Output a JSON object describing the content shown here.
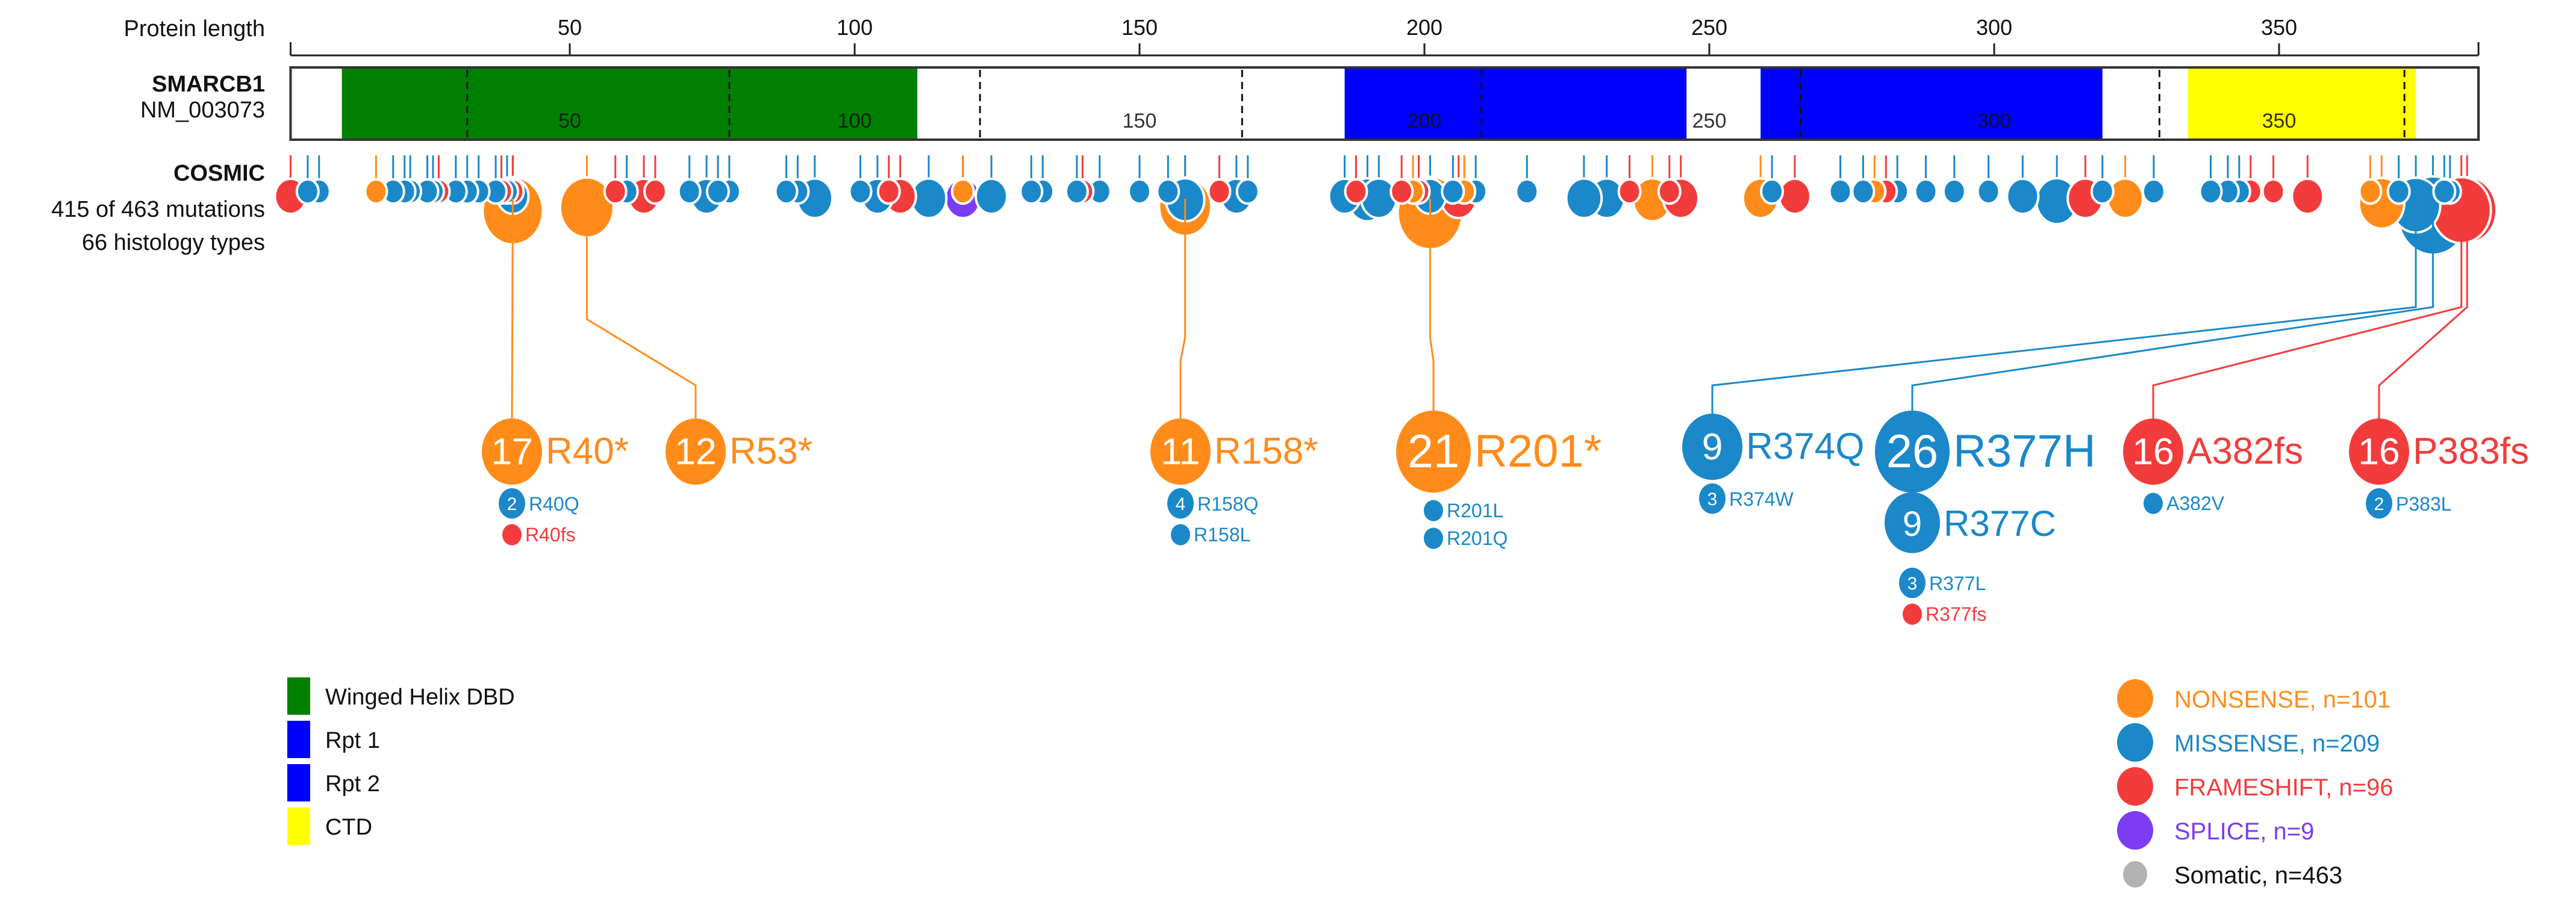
{
  "chart_data": {
    "type": "lollipop",
    "title": "",
    "axis": {
      "label": "Protein length",
      "range": [
        1,
        385
      ],
      "ticks": [
        50,
        100,
        150,
        200,
        250,
        300,
        350
      ]
    },
    "gene": {
      "symbol": "SMARCB1",
      "transcript": "NM_003073",
      "length": 385,
      "inner_labels": [
        50,
        100,
        150,
        200,
        250,
        300,
        350
      ],
      "exon_boundaries": [
        32,
        78,
        122,
        168,
        210,
        266,
        329,
        372
      ],
      "domains": [
        {
          "name": "Winged Helix DBD",
          "start": 10,
          "end": 111,
          "color": "#008000"
        },
        {
          "name": "Rpt 1",
          "start": 186,
          "end": 246,
          "color": "#0000ff"
        },
        {
          "name": "Rpt 2",
          "start": 259,
          "end": 319,
          "color": "#0000ff"
        },
        {
          "name": "CTD",
          "start": 334,
          "end": 374,
          "color": "#ffff00"
        }
      ]
    },
    "track": {
      "name": "COSMIC",
      "summary_line1": "415 of 463 mutations",
      "summary_line2": "66 histology types"
    },
    "mutation_types": [
      {
        "key": "nonsense",
        "label": "NONSENSE, n=101",
        "n": 101,
        "color": "#ff8c1a"
      },
      {
        "key": "missense",
        "label": "MISSENSE, n=209",
        "n": 209,
        "color": "#1a88c9"
      },
      {
        "key": "frameshift",
        "label": "FRAMESHIFT, n=96",
        "n": 96,
        "color": "#f23c3c"
      },
      {
        "key": "splice",
        "label": "SPLICE, n=9",
        "n": 9,
        "color": "#7b3cf2"
      },
      {
        "key": "somatic",
        "label": "Somatic, n=463",
        "n": 463,
        "color": "#b3b3b3"
      }
    ],
    "lollipops": [
      {
        "pos": 1,
        "type": "frameshift",
        "count": 2
      },
      {
        "pos": 4,
        "type": "missense",
        "count": 1
      },
      {
        "pos": 6,
        "type": "missense",
        "count": 1
      },
      {
        "pos": 16,
        "type": "nonsense",
        "count": 1
      },
      {
        "pos": 19,
        "type": "missense",
        "count": 1
      },
      {
        "pos": 21,
        "type": "missense",
        "count": 1
      },
      {
        "pos": 22,
        "type": "missense",
        "count": 1
      },
      {
        "pos": 25,
        "type": "missense",
        "count": 1
      },
      {
        "pos": 26,
        "type": "missense",
        "count": 1
      },
      {
        "pos": 27,
        "type": "frameshift",
        "count": 1
      },
      {
        "pos": 30,
        "type": "missense",
        "count": 1
      },
      {
        "pos": 32,
        "type": "missense",
        "count": 1
      },
      {
        "pos": 34,
        "type": "missense",
        "count": 1
      },
      {
        "pos": 37,
        "type": "missense",
        "count": 1
      },
      {
        "pos": 38,
        "type": "frameshift",
        "count": 1
      },
      {
        "pos": 39,
        "type": "missense",
        "count": 1
      },
      {
        "pos": 40,
        "type": "nonsense",
        "count": 17
      },
      {
        "pos": 40,
        "type": "missense",
        "count": 2
      },
      {
        "pos": 40,
        "type": "frameshift",
        "count": 1
      },
      {
        "pos": 53,
        "type": "nonsense",
        "count": 12
      },
      {
        "pos": 58,
        "type": "frameshift",
        "count": 1
      },
      {
        "pos": 60,
        "type": "missense",
        "count": 1
      },
      {
        "pos": 63,
        "type": "frameshift",
        "count": 2
      },
      {
        "pos": 65,
        "type": "frameshift",
        "count": 1
      },
      {
        "pos": 71,
        "type": "missense",
        "count": 1
      },
      {
        "pos": 74,
        "type": "missense",
        "count": 2
      },
      {
        "pos": 76,
        "type": "missense",
        "count": 1
      },
      {
        "pos": 78,
        "type": "missense",
        "count": 1
      },
      {
        "pos": 88,
        "type": "missense",
        "count": 1
      },
      {
        "pos": 90,
        "type": "missense",
        "count": 1
      },
      {
        "pos": 93,
        "type": "missense",
        "count": 3
      },
      {
        "pos": 101,
        "type": "missense",
        "count": 1
      },
      {
        "pos": 104,
        "type": "missense",
        "count": 2
      },
      {
        "pos": 106,
        "type": "frameshift",
        "count": 1
      },
      {
        "pos": 108,
        "type": "frameshift",
        "count": 2
      },
      {
        "pos": 113,
        "type": "missense",
        "count": 3
      },
      {
        "pos": 119,
        "type": "splice",
        "count": 3
      },
      {
        "pos": 119,
        "type": "nonsense",
        "count": 1
      },
      {
        "pos": 124,
        "type": "missense",
        "count": 2
      },
      {
        "pos": 131,
        "type": "missense",
        "count": 1
      },
      {
        "pos": 133,
        "type": "missense",
        "count": 1
      },
      {
        "pos": 139,
        "type": "missense",
        "count": 1
      },
      {
        "pos": 140,
        "type": "frameshift",
        "count": 1
      },
      {
        "pos": 143,
        "type": "missense",
        "count": 1
      },
      {
        "pos": 150,
        "type": "missense",
        "count": 1
      },
      {
        "pos": 158,
        "type": "nonsense",
        "count": 11
      },
      {
        "pos": 158,
        "type": "missense",
        "count": 4
      },
      {
        "pos": 155,
        "type": "missense",
        "count": 1
      },
      {
        "pos": 164,
        "type": "frameshift",
        "count": 1
      },
      {
        "pos": 167,
        "type": "missense",
        "count": 2
      },
      {
        "pos": 169,
        "type": "missense",
        "count": 1
      },
      {
        "pos": 186,
        "type": "missense",
        "count": 2
      },
      {
        "pos": 188,
        "type": "frameshift",
        "count": 1
      },
      {
        "pos": 190,
        "type": "missense",
        "count": 4
      },
      {
        "pos": 192,
        "type": "missense",
        "count": 3
      },
      {
        "pos": 196,
        "type": "frameshift",
        "count": 1
      },
      {
        "pos": 198,
        "type": "nonsense",
        "count": 1
      },
      {
        "pos": 199,
        "type": "frameshift",
        "count": 1
      },
      {
        "pos": 201,
        "type": "nonsense",
        "count": 21
      },
      {
        "pos": 201,
        "type": "missense",
        "count": 2
      },
      {
        "pos": 205,
        "type": "missense",
        "count": 1
      },
      {
        "pos": 206,
        "type": "frameshift",
        "count": 3
      },
      {
        "pos": 207,
        "type": "nonsense",
        "count": 1
      },
      {
        "pos": 209,
        "type": "missense",
        "count": 1
      },
      {
        "pos": 218,
        "type": "missense",
        "count": 1
      },
      {
        "pos": 228,
        "type": "missense",
        "count": 3
      },
      {
        "pos": 232,
        "type": "missense",
        "count": 3
      },
      {
        "pos": 236,
        "type": "frameshift",
        "count": 1
      },
      {
        "pos": 240,
        "type": "nonsense",
        "count": 4
      },
      {
        "pos": 243,
        "type": "frameshift",
        "count": 1
      },
      {
        "pos": 245,
        "type": "frameshift",
        "count": 3
      },
      {
        "pos": 259,
        "type": "nonsense",
        "count": 3
      },
      {
        "pos": 261,
        "type": "missense",
        "count": 1
      },
      {
        "pos": 265,
        "type": "frameshift",
        "count": 2
      },
      {
        "pos": 273,
        "type": "missense",
        "count": 1
      },
      {
        "pos": 277,
        "type": "missense",
        "count": 1
      },
      {
        "pos": 279,
        "type": "nonsense",
        "count": 1
      },
      {
        "pos": 281,
        "type": "frameshift",
        "count": 1
      },
      {
        "pos": 283,
        "type": "missense",
        "count": 1
      },
      {
        "pos": 288,
        "type": "missense",
        "count": 1
      },
      {
        "pos": 293,
        "type": "missense",
        "count": 1
      },
      {
        "pos": 299,
        "type": "missense",
        "count": 1
      },
      {
        "pos": 305,
        "type": "missense",
        "count": 2
      },
      {
        "pos": 311,
        "type": "missense",
        "count": 5
      },
      {
        "pos": 316,
        "type": "frameshift",
        "count": 3
      },
      {
        "pos": 319,
        "type": "missense",
        "count": 1
      },
      {
        "pos": 323,
        "type": "nonsense",
        "count": 3
      },
      {
        "pos": 328,
        "type": "missense",
        "count": 1
      },
      {
        "pos": 338,
        "type": "missense",
        "count": 1
      },
      {
        "pos": 341,
        "type": "missense",
        "count": 1
      },
      {
        "pos": 343,
        "type": "missense",
        "count": 1
      },
      {
        "pos": 345,
        "type": "frameshift",
        "count": 1
      },
      {
        "pos": 349,
        "type": "frameshift",
        "count": 1
      },
      {
        "pos": 355,
        "type": "frameshift",
        "count": 2
      },
      {
        "pos": 366,
        "type": "nonsense",
        "count": 1
      },
      {
        "pos": 368,
        "type": "nonsense",
        "count": 7
      },
      {
        "pos": 371,
        "type": "missense",
        "count": 1
      },
      {
        "pos": 374,
        "type": "missense",
        "count": 9
      },
      {
        "pos": 377,
        "type": "missense",
        "count": 26
      },
      {
        "pos": 379,
        "type": "missense",
        "count": 1
      },
      {
        "pos": 380,
        "type": "missense",
        "count": 1
      },
      {
        "pos": 382,
        "type": "frameshift",
        "count": 16
      },
      {
        "pos": 383,
        "type": "frameshift",
        "count": 16
      }
    ],
    "callouts": [
      {
        "pos": 40,
        "main": {
          "count": 17,
          "label": "R40*",
          "type": "nonsense"
        },
        "subs": [
          {
            "count": 2,
            "label": "R40Q",
            "type": "missense"
          },
          {
            "count": null,
            "label": "R40fs",
            "type": "frameshift"
          }
        ]
      },
      {
        "pos": 53,
        "main": {
          "count": 12,
          "label": "R53*",
          "type": "nonsense"
        },
        "subs": []
      },
      {
        "pos": 158,
        "main": {
          "count": 11,
          "label": "R158*",
          "type": "nonsense"
        },
        "subs": [
          {
            "count": 4,
            "label": "R158Q",
            "type": "missense"
          },
          {
            "count": null,
            "label": "R158L",
            "type": "missense"
          }
        ]
      },
      {
        "pos": 201,
        "main": {
          "count": 21,
          "label": "R201*",
          "type": "nonsense"
        },
        "subs": [
          {
            "count": null,
            "label": "R201L",
            "type": "missense"
          },
          {
            "count": null,
            "label": "R201Q",
            "type": "missense"
          }
        ]
      },
      {
        "pos": 374,
        "main": {
          "count": 9,
          "label": "R374Q",
          "type": "missense"
        },
        "subs": [
          {
            "count": 3,
            "label": "R374W",
            "type": "missense"
          }
        ]
      },
      {
        "pos": 377,
        "main": {
          "count": 26,
          "label": "R377H",
          "type": "missense"
        },
        "subs": [
          {
            "count": 9,
            "label": "R377C",
            "type": "missense",
            "large": true
          },
          {
            "count": 3,
            "label": "R377L",
            "type": "missense"
          },
          {
            "count": null,
            "label": "R377fs",
            "type": "frameshift"
          }
        ]
      },
      {
        "pos": 382,
        "main": {
          "count": 16,
          "label": "A382fs",
          "type": "frameshift"
        },
        "subs": [
          {
            "count": null,
            "label": "A382V",
            "type": "missense"
          }
        ]
      },
      {
        "pos": 383,
        "main": {
          "count": 16,
          "label": "P383fs",
          "type": "frameshift"
        },
        "subs": [
          {
            "count": 2,
            "label": "P383L",
            "type": "missense"
          }
        ]
      }
    ],
    "domain_legend": [
      "Winged Helix DBD",
      "Rpt 1",
      "Rpt 2",
      "CTD"
    ],
    "legend_placement": "bottom"
  }
}
